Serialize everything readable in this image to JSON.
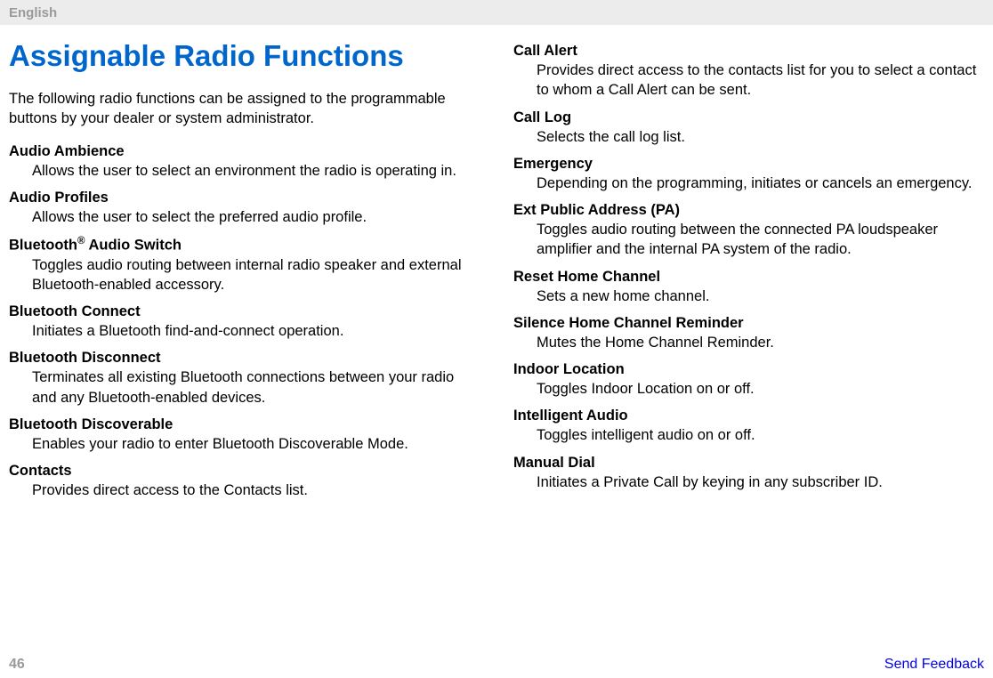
{
  "header": {
    "language": "English"
  },
  "title": "Assignable Radio Functions",
  "intro": "The following radio functions can be assigned to the programmable buttons by your dealer or system administrator.",
  "left": [
    {
      "term": "Audio Ambience",
      "def": "Allows the user to select an environment the radio is operating in."
    },
    {
      "term": "Audio Profiles",
      "def": "Allows the user to select the preferred audio profile."
    },
    {
      "term_html": "Bluetooth® Audio Switch",
      "def": "Toggles audio routing between internal radio speaker and external Bluetooth-enabled accessory."
    },
    {
      "term": "Bluetooth Connect",
      "def": "Initiates a Bluetooth find-and-connect operation."
    },
    {
      "term": "Bluetooth Disconnect",
      "def": "Terminates all existing Bluetooth connections between your radio and any Bluetooth-enabled devices."
    },
    {
      "term": "Bluetooth Discoverable",
      "def": "Enables your radio to enter Bluetooth Discoverable Mode."
    },
    {
      "term": "Contacts",
      "def": "Provides direct access to the Contacts list."
    }
  ],
  "right": [
    {
      "term": "Call Alert",
      "def": "Provides direct access to the contacts list for you to select a contact to whom a Call Alert can be sent."
    },
    {
      "term": "Call Log",
      "def": "Selects the call log list."
    },
    {
      "term": "Emergency",
      "def": "Depending on the programming, initiates or cancels an emergency."
    },
    {
      "term": "Ext Public Address (PA)",
      "def": "Toggles audio routing between the connected PA loudspeaker amplifier and the internal PA system of the radio."
    },
    {
      "term": "Reset Home Channel",
      "def": "Sets a new home channel."
    },
    {
      "term": "Silence Home Channel Reminder",
      "def": "Mutes the Home Channel Reminder."
    },
    {
      "term": "Indoor Location",
      "def": "Toggles Indoor Location on or off."
    },
    {
      "term": "Intelligent Audio",
      "def": "Toggles intelligent audio on or off."
    },
    {
      "term": "Manual Dial",
      "def": "Initiates a Private Call by keying in any subscriber ID."
    }
  ],
  "footer": {
    "page": "46",
    "feedback": "Send Feedback"
  },
  "bluetooth_tm": {
    "prefix": "Bluetooth",
    "sup": "®",
    "suffix": " Audio Switch"
  }
}
